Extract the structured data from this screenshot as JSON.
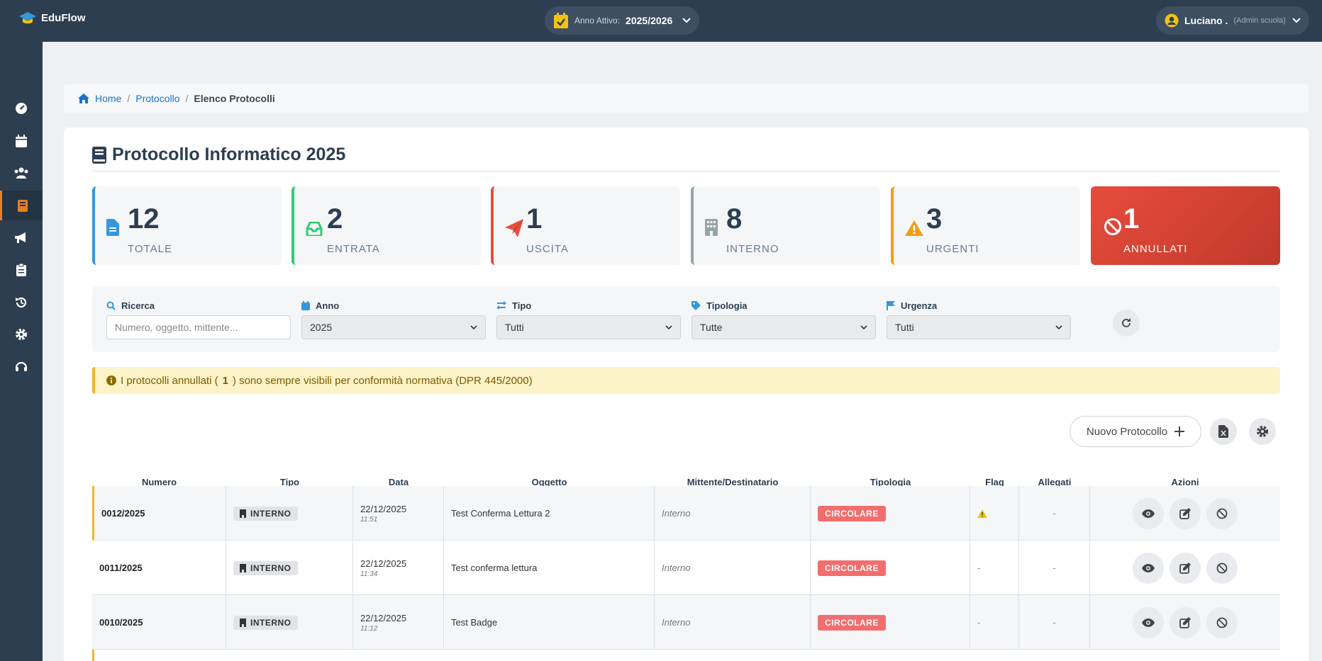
{
  "app": {
    "name": "EduFlow",
    "year_label": "Anno Attivo:",
    "year_value": "2025/2026"
  },
  "user": {
    "name": "Luciano .",
    "role": "(Admin scuola)"
  },
  "breadcrumb": {
    "home": "Home",
    "section": "Protocollo",
    "current": "Elenco Protocolli"
  },
  "page": {
    "title": "Protocollo Informatico 2025"
  },
  "stats": [
    {
      "value": "12",
      "label": "TOTALE",
      "color": "#3498db",
      "icon": "file-icon"
    },
    {
      "value": "2",
      "label": "ENTRATA",
      "color": "#2ecc71",
      "icon": "inbox-icon"
    },
    {
      "value": "1",
      "label": "USCITA",
      "color": "#e74c3c",
      "icon": "paper-plane-icon"
    },
    {
      "value": "8",
      "label": "INTERNO",
      "color": "#95a5a6",
      "icon": "building-icon"
    },
    {
      "value": "3",
      "label": "URGENTI",
      "color": "#f39c12",
      "icon": "warning-icon"
    },
    {
      "value": "1",
      "label": "ANNULLATI",
      "color": "#e74c3c",
      "icon": "ban-icon"
    }
  ],
  "filters": {
    "search": {
      "label": "Ricerca",
      "placeholder": "Numero, oggetto, mittente..."
    },
    "anno": {
      "label": "Anno",
      "value": "2025"
    },
    "tipo": {
      "label": "Tipo",
      "value": "Tutti"
    },
    "tipologia": {
      "label": "Tipologia",
      "value": "Tutte"
    },
    "urgenza": {
      "label": "Urgenza",
      "value": "Tutti"
    }
  },
  "notice": {
    "before": "I protocolli annullati (",
    "count": "1",
    "after": ") sono sempre visibili per conformità normativa (DPR 445/2000)"
  },
  "actions": {
    "new": "Nuovo Protocollo"
  },
  "table": {
    "headers": [
      "Numero",
      "Tipo",
      "Data",
      "Oggetto",
      "Mittente/Destinatario",
      "Tipologia",
      "Flag",
      "Allegati",
      "Azioni"
    ],
    "rows": [
      {
        "numero": "0012/2025",
        "tipo": "INTERNO",
        "data": "22/12/2025",
        "ora": "11:51",
        "oggetto": "Test Conferma Lettura 2",
        "mittente": "Interno",
        "tipologia": "CIRCOLARE",
        "flag": "urgent",
        "allegati": "-"
      },
      {
        "numero": "0011/2025",
        "tipo": "INTERNO",
        "data": "22/12/2025",
        "ora": "11:34",
        "oggetto": "Test conferma lettura",
        "mittente": "Interno",
        "tipologia": "CIRCOLARE",
        "flag": "-",
        "allegati": "-"
      },
      {
        "numero": "0010/2025",
        "tipo": "INTERNO",
        "data": "22/12/2025",
        "ora": "11:12",
        "oggetto": "Test Badge",
        "mittente": "Interno",
        "tipologia": "CIRCOLARE",
        "flag": "-",
        "allegati": "-"
      }
    ]
  }
}
